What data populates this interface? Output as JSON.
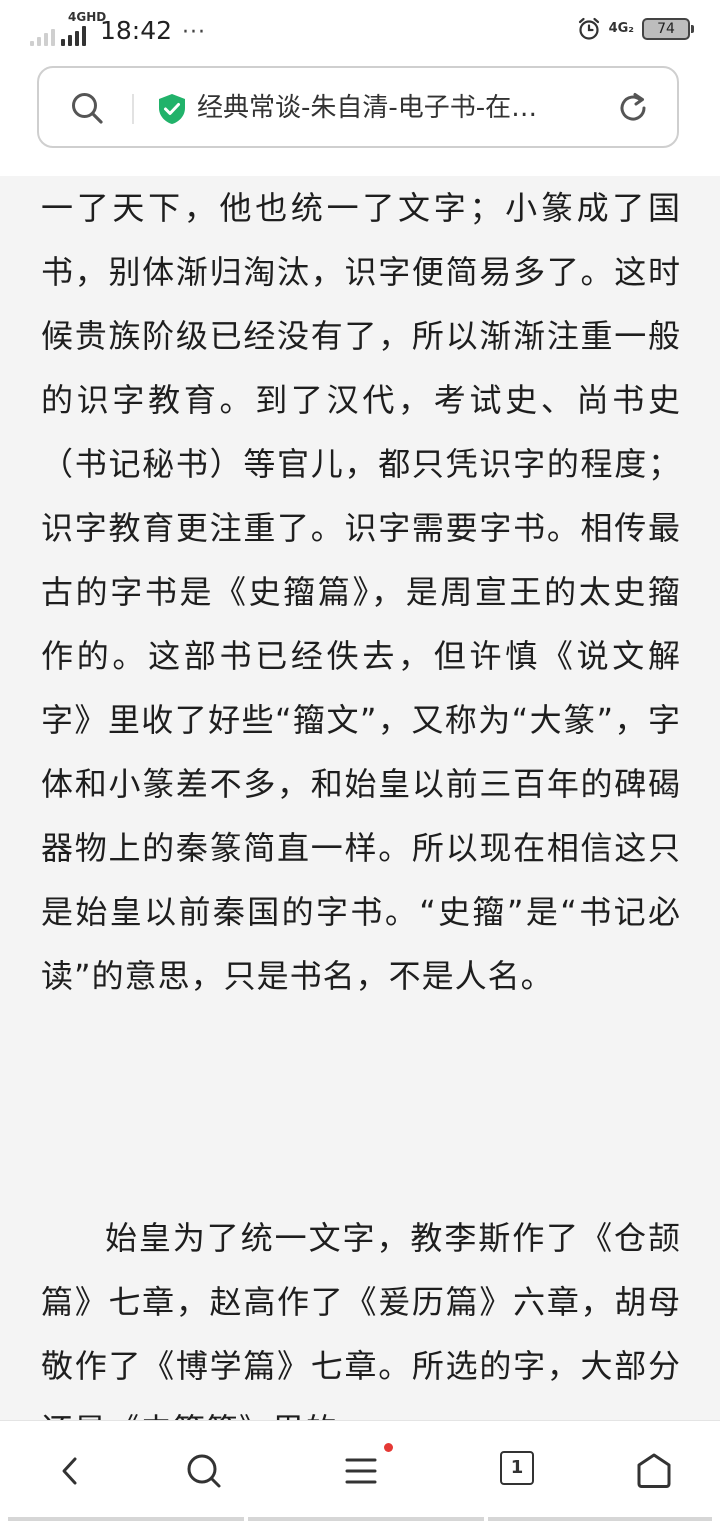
{
  "status_bar": {
    "network_label": "4GHD",
    "time": "18:42",
    "more_dots": "···",
    "network_right": "4G₂",
    "battery": "74"
  },
  "address_bar": {
    "title": "经典常谈-朱自清-电子书-在…"
  },
  "article": {
    "paragraph_1": "一了天下，他也统一了文字；小篆成了国书，别体渐归淘汰，识字便简易多了。这时候贵族阶级已经没有了，所以渐渐注重一般的识字教育。到了汉代，考试史、尚书史（书记秘书）等官儿，都只凭识字的程度；识字教育更注重了。识字需要字书。相传最古的字书是《史籀篇》，是周宣王的太史籀作的。这部书已经佚去，但许慎《说文解字》里收了好些“籀文”，又称为“大篆”，字体和小篆差不多，和始皇以前三百年的碑碣器物上的秦篆简直一样。所以现在相信这只是始皇以前秦国的字书。“史籀”是“书记必读”的意思，只是书名，不是人名。",
    "paragraph_2": "始皇为了统一文字，教李斯作了《仓颉篇》七章，赵高作了《爰历篇》六章，胡母敬作了《博学篇》七章。所选的字，大部分还是《史籀篇》里的"
  },
  "bottom_nav": {
    "tab_count": "1"
  },
  "colors": {
    "accent_green": "#21b26a",
    "notification_red": "#e53935",
    "background": "#f4f4f4"
  }
}
